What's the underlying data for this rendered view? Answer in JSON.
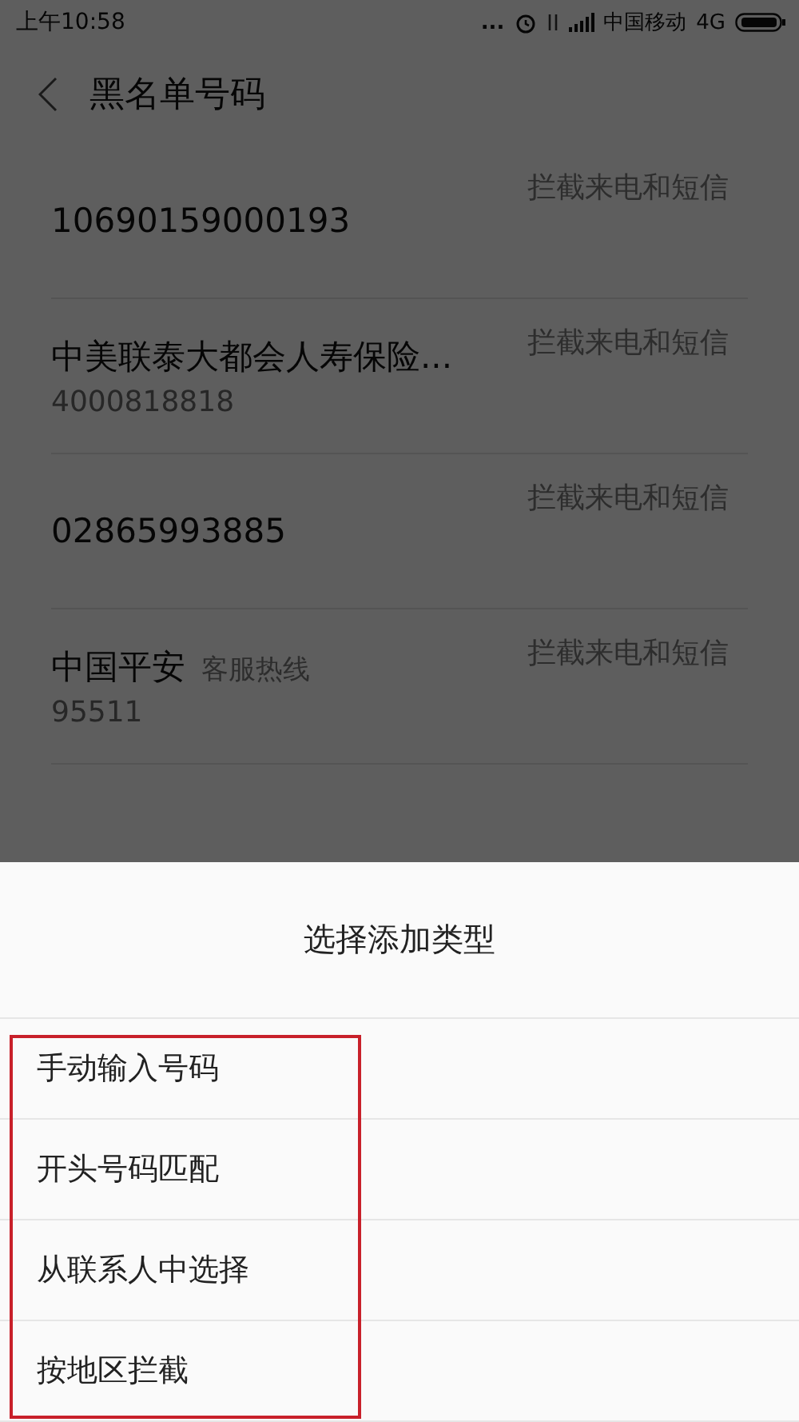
{
  "status_bar": {
    "time": "上午10:58",
    "dots": "...",
    "carrier": "中国移动",
    "network": "4G"
  },
  "header": {
    "title": "黑名单号码"
  },
  "entries": [
    {
      "name": "10690159000193",
      "action": "拦截来电和短信"
    },
    {
      "name": "中美联泰大都会人寿保险...",
      "number": "4000818818",
      "action": "拦截来电和短信"
    },
    {
      "name": "02865993885",
      "action": "拦截来电和短信"
    },
    {
      "name": "中国平安",
      "tag": "客服热线",
      "number": "95511",
      "action": "拦截来电和短信"
    }
  ],
  "sheet": {
    "title": "选择添加类型",
    "options": [
      "手动输入号码",
      "开头号码匹配",
      "从联系人中选择",
      "按地区拦截"
    ]
  }
}
